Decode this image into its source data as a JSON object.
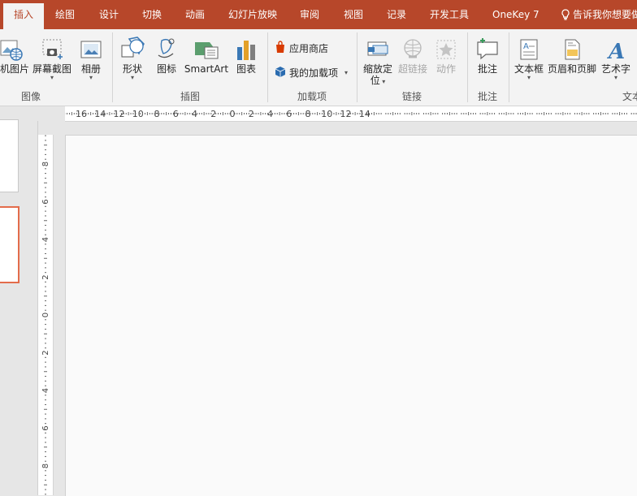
{
  "tabs": [
    {
      "id": "insert",
      "label": "插入"
    },
    {
      "id": "draw",
      "label": "绘图"
    },
    {
      "id": "design",
      "label": "设计"
    },
    {
      "id": "transitions",
      "label": "切换"
    },
    {
      "id": "animations",
      "label": "动画"
    },
    {
      "id": "slideshow",
      "label": "幻灯片放映"
    },
    {
      "id": "review",
      "label": "审阅"
    },
    {
      "id": "view",
      "label": "视图"
    },
    {
      "id": "record",
      "label": "记录"
    },
    {
      "id": "developer",
      "label": "开发工具"
    },
    {
      "id": "onekey",
      "label": "OneKey 7"
    }
  ],
  "tell_me": "告诉我你想要做什么",
  "ribbon": {
    "images": {
      "online_pictures": "机图片",
      "screenshot": "屏幕截图",
      "album": "相册",
      "group": "图像"
    },
    "illustrations": {
      "shapes": "形状",
      "icons": "图标",
      "smartart": "SmartArt",
      "chart": "图表",
      "group": "插图"
    },
    "addins": {
      "store": "应用商店",
      "my_addins": "我的加载项",
      "group": "加载项"
    },
    "links": {
      "zoom_line1": "缩放定",
      "zoom_line2": "位",
      "hyperlink": "超链接",
      "action": "动作",
      "group": "链接"
    },
    "comments": {
      "comment": "批注",
      "group": "批注"
    },
    "text": {
      "textbox": "文本框",
      "header_footer": "页眉和页脚",
      "wordart": "艺术字",
      "group": "文本"
    }
  },
  "ruler": {
    "h_labels": [
      "16",
      "14",
      "12",
      "10",
      "8",
      "6",
      "4",
      "2",
      "0",
      "2",
      "4",
      "6",
      "8",
      "10",
      "12",
      "14"
    ],
    "v_labels": [
      "8",
      "6",
      "4",
      "2",
      "0",
      "2",
      "4",
      "6",
      "8"
    ]
  },
  "colors": {
    "accent": "#b7472a",
    "selected_thumb": "#e36c4b"
  }
}
